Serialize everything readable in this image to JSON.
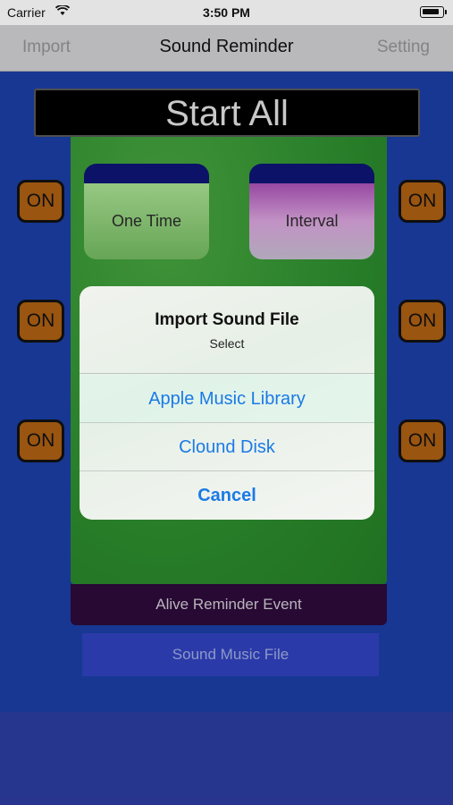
{
  "status_bar": {
    "carrier": "Carrier",
    "time": "3:50 PM"
  },
  "nav": {
    "left": "Import",
    "title": "Sound Reminder",
    "right": "Setting"
  },
  "main": {
    "start_all": "Start All",
    "tiles": [
      {
        "label": "One Time"
      },
      {
        "label": "Interval"
      }
    ],
    "on_buttons": [
      "ON",
      "ON",
      "ON",
      "ON",
      "ON",
      "ON"
    ],
    "alive_event": "Alive Reminder Event",
    "sound_file": "Sound Music File"
  },
  "alert": {
    "title": "Import Sound File",
    "message": "Select",
    "actions": [
      "Apple Music Library",
      "Clound Disk",
      "Cancel"
    ]
  },
  "colors": {
    "accent": "#1a7ae6",
    "panel_green": "#2d8a2e",
    "on_button": "#a85d12",
    "background_blue": "#1a3ca0"
  }
}
